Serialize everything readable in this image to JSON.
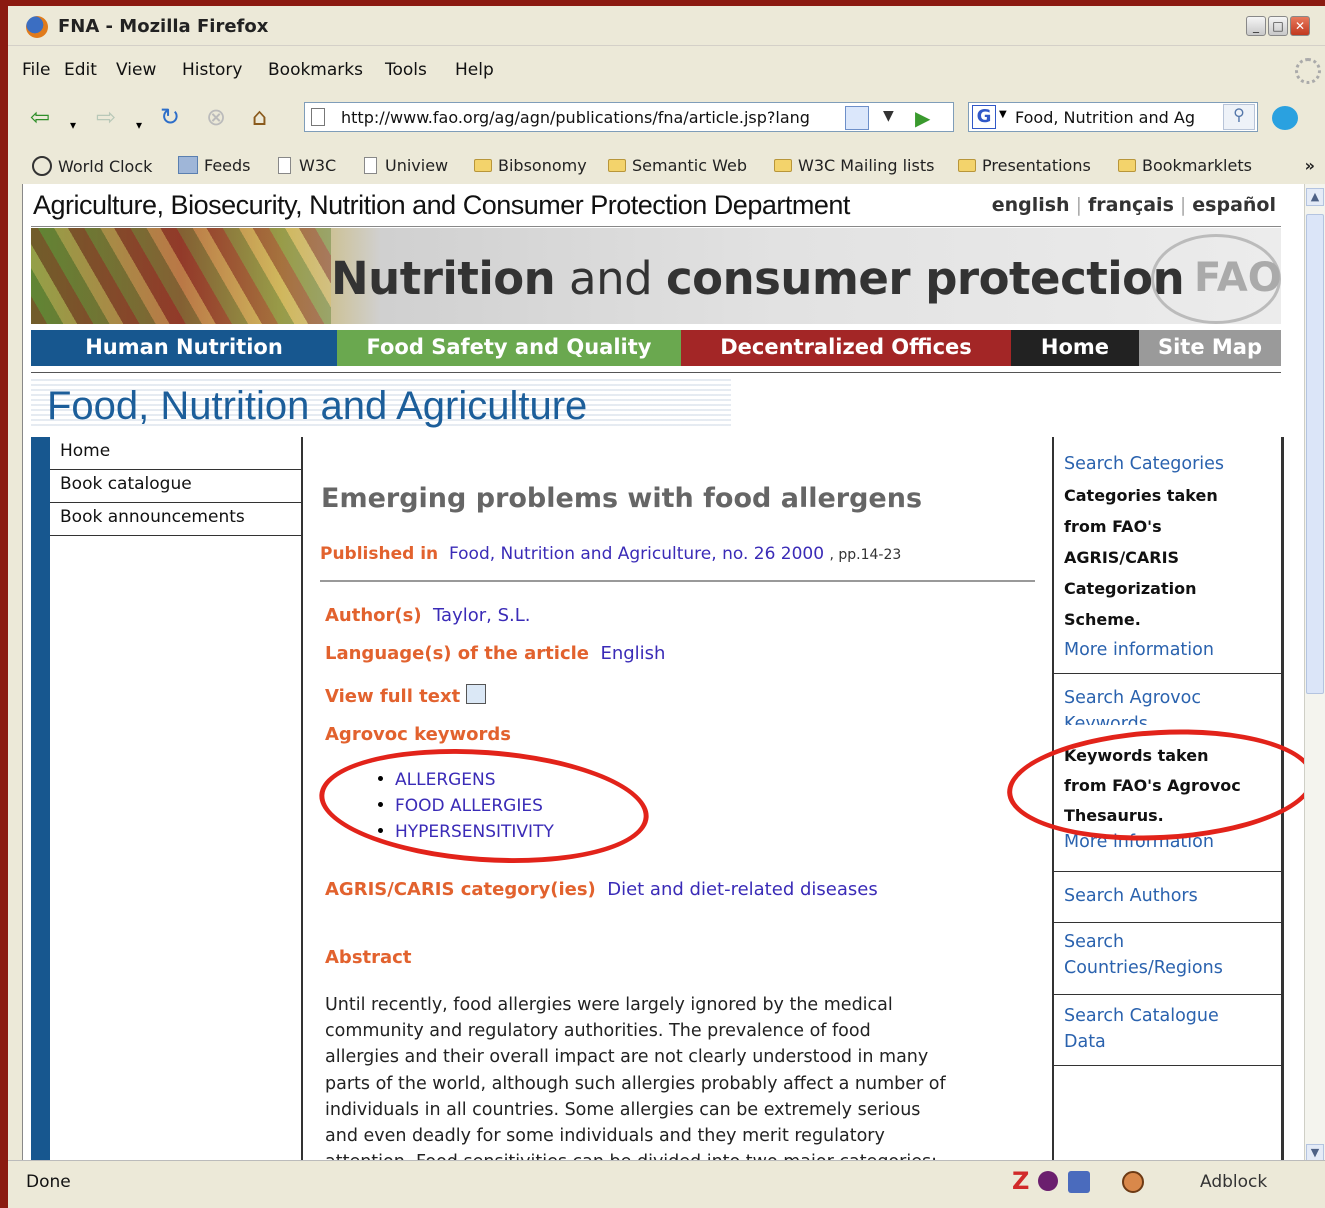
{
  "window": {
    "title": "FNA - Mozilla Firefox"
  },
  "menubar": [
    "File",
    "Edit",
    "View",
    "History",
    "Bookmarks",
    "Tools",
    "Help"
  ],
  "navbar": {
    "url": "http://www.fao.org/ag/agn/publications/fna/article.jsp?lang",
    "search_value": "Food, Nutrition and Ag"
  },
  "bookmarks": [
    "World Clock",
    "Feeds",
    "W3C",
    "Uniview",
    "Bibsonomy",
    "Semantic Web",
    "W3C Mailing lists",
    "Presentations",
    "Bookmarklets"
  ],
  "page": {
    "dept_title": "Agriculture, Biosecurity, Nutrition and Consumer Protection Department",
    "languages": [
      "english",
      "français",
      "español"
    ],
    "banner_word1": "Nutrition",
    "banner_word2": " and ",
    "banner_word3": "consumer protection",
    "mainnav": [
      "Human Nutrition",
      "Food Safety and Quality",
      "Decentralized Offices",
      "Home",
      "Site Map"
    ],
    "heading": "Food, Nutrition and Agriculture",
    "leftnav": [
      "Home",
      "Book catalogue",
      "Book announcements"
    ],
    "article": {
      "title": "Emerging problems with food allergens",
      "published_label": "Published in",
      "published_value": "Food, Nutrition and Agriculture, no. 26 2000",
      "pages": ", pp.14-23",
      "author_label": "Author(s)",
      "author_value": "Taylor, S.L.",
      "language_label": "Language(s) of the article",
      "language_value": "English",
      "fulltext_label": "View full text",
      "keywords_label": "Agrovoc keywords",
      "keywords": [
        "ALLERGENS",
        "FOOD ALLERGIES",
        "HYPERSENSITIVITY"
      ],
      "category_label": "AGRIS/CARIS category(ies)",
      "category_value": "Diet and diet-related diseases",
      "abstract_label": "Abstract",
      "abstract": [
        "Until recently, food allergies were largely ignored by the medical",
        "community and regulatory authorities. The prevalence of food",
        "allergies and their overall impact are not clearly understood in many",
        "parts of the world, although such allergies probably affect a number of",
        "individuals in all countries. Some allergies can be extremely serious",
        "and even deadly for some individuals and they merit regulatory",
        "attention. Food sensitivities can be divided into two major categories:"
      ]
    },
    "right": {
      "search_categories": "Search Categories",
      "categories_note": [
        "Categories taken",
        "from FAO's",
        "AGRIS/CARIS",
        "Categorization",
        "Scheme."
      ],
      "more_info_1": "More information",
      "search_agrovoc": "Search Agrovoc",
      "search_agrovoc_2": "Keywords",
      "agrovoc_note": [
        "Keywords taken",
        "from FAO's Agrovoc",
        "Thesaurus."
      ],
      "more_info_2": "More information",
      "search_authors": "Search Authors",
      "search_countries_1": "Search",
      "search_countries_2": "Countries/Regions",
      "search_catalogue_1": "Search Catalogue",
      "search_catalogue_2": "Data"
    }
  },
  "statusbar": {
    "status": "Done",
    "z_icon_text": "Z",
    "adblock": "Adblock"
  },
  "colors": {
    "nav_human": "#17578f",
    "nav_food": "#6aa84f",
    "nav_decentral": "#a32626",
    "nav_home": "#222222",
    "nav_sitemap": "#9a9a9a",
    "annotation": "#e2231a"
  }
}
